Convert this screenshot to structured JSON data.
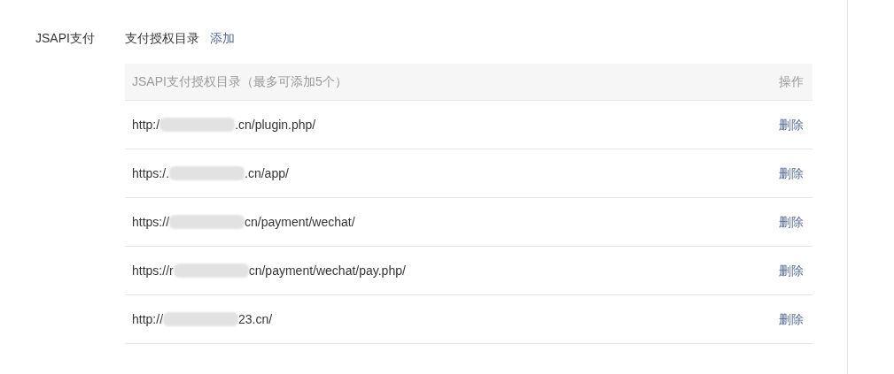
{
  "section_label": "JSAPI支付",
  "title": "支付授权目录",
  "add_link": "添加",
  "table": {
    "columns": [
      "JSAPI支付授权目录（最多可添加5个）",
      "操作"
    ],
    "rows": [
      {
        "url_start": "http:/",
        "url_end": ".cn/plugin.php/",
        "action": "删除"
      },
      {
        "url_start": "https:/.",
        "url_end": ".cn/app/",
        "action": "删除"
      },
      {
        "url_start": "https://",
        "url_end": "cn/payment/wechat/",
        "action": "删除"
      },
      {
        "url_start": "https://r",
        "url_end": "cn/payment/wechat/pay.php/",
        "action": "删除"
      },
      {
        "url_start": "http://",
        "url_end": "23.cn/",
        "action": "删除"
      }
    ]
  }
}
